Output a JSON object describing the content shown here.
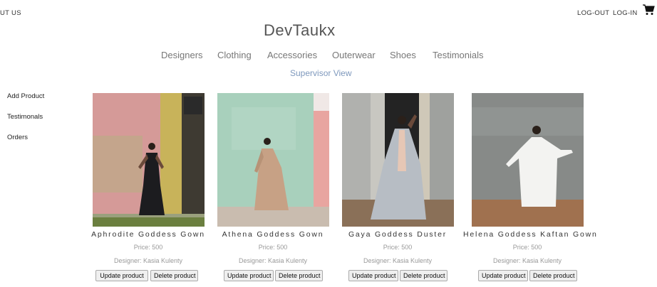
{
  "header": {
    "left_link": "UT US",
    "logout": "LOG-OUT",
    "login": "LOG-IN",
    "brand": "DevTaukx"
  },
  "categories": [
    "Designers",
    "Clothing",
    "Accessories",
    "Outerwear",
    "Shoes",
    "Testimonials"
  ],
  "supervisor_label": "Supervisor View",
  "sidebar": [
    "Add Product",
    "Testimonals",
    "Orders"
  ],
  "products": [
    {
      "name": "Aphrodite Goddess Gown",
      "price": "Price: 500",
      "designer": "Designer: Kasia Kulenty",
      "update": "Update product",
      "delete": "Delete product"
    },
    {
      "name": "Athena Goddess Gown",
      "price": "Price: 500",
      "designer": "Designer: Kasia Kulenty",
      "update": "Update product",
      "delete": "Delete product"
    },
    {
      "name": "Gaya Goddess Duster",
      "price": "Price: 500",
      "designer": "Designer: Kasia Kulenty",
      "update": "Update product",
      "delete": "Delete product"
    },
    {
      "name": "Helena Goddess Kaftan Gown",
      "price": "Price: 500",
      "designer": "Designer: Kasia Kulenty",
      "update": "Update product",
      "delete": "Delete product"
    }
  ]
}
